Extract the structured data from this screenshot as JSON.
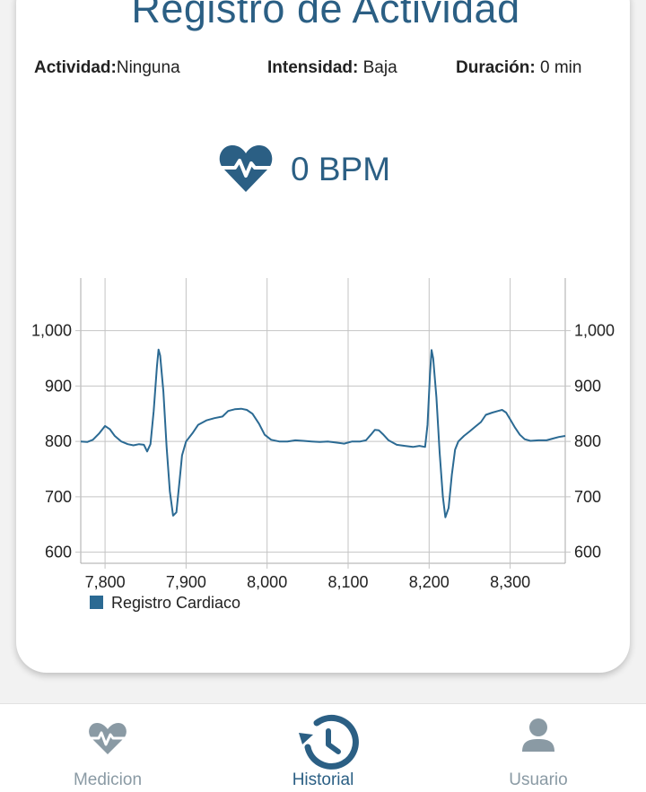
{
  "page": {
    "title": "Registro de Actividad",
    "activity_label": "Actividad:",
    "activity_value": "Ninguna",
    "intensity_label": "Intensidad:",
    "intensity_value": "Baja",
    "duration_label": "Duración:",
    "duration_value": "0 min",
    "heart_icon": "heart-pulse-icon",
    "bpm_value": "0 BPM"
  },
  "chart_data": {
    "type": "line",
    "series": [
      {
        "name": "Registro Cardiaco",
        "color": "#2b6a93",
        "points": [
          [
            7770,
            800
          ],
          [
            7778,
            799
          ],
          [
            7785,
            803
          ],
          [
            7793,
            815
          ],
          [
            7800,
            828
          ],
          [
            7806,
            822
          ],
          [
            7812,
            810
          ],
          [
            7820,
            800
          ],
          [
            7828,
            795
          ],
          [
            7835,
            793
          ],
          [
            7842,
            795
          ],
          [
            7848,
            794
          ],
          [
            7852,
            782
          ],
          [
            7856,
            795
          ],
          [
            7860,
            855
          ],
          [
            7864,
            935
          ],
          [
            7866,
            966
          ],
          [
            7868,
            955
          ],
          [
            7872,
            890
          ],
          [
            7876,
            790
          ],
          [
            7880,
            710
          ],
          [
            7884,
            666
          ],
          [
            7888,
            672
          ],
          [
            7892,
            730
          ],
          [
            7895,
            775
          ],
          [
            7900,
            800
          ],
          [
            7908,
            815
          ],
          [
            7915,
            830
          ],
          [
            7925,
            838
          ],
          [
            7935,
            842
          ],
          [
            7945,
            845
          ],
          [
            7952,
            855
          ],
          [
            7960,
            858
          ],
          [
            7968,
            859
          ],
          [
            7975,
            857
          ],
          [
            7982,
            850
          ],
          [
            7990,
            832
          ],
          [
            7997,
            812
          ],
          [
            8005,
            803
          ],
          [
            8015,
            800
          ],
          [
            8025,
            800
          ],
          [
            8035,
            802
          ],
          [
            8045,
            801
          ],
          [
            8055,
            800
          ],
          [
            8065,
            799
          ],
          [
            8075,
            800
          ],
          [
            8085,
            798
          ],
          [
            8095,
            796
          ],
          [
            8105,
            800
          ],
          [
            8115,
            800
          ],
          [
            8122,
            802
          ],
          [
            8128,
            812
          ],
          [
            8133,
            821
          ],
          [
            8138,
            820
          ],
          [
            8143,
            813
          ],
          [
            8150,
            802
          ],
          [
            8160,
            794
          ],
          [
            8170,
            792
          ],
          [
            8180,
            790
          ],
          [
            8188,
            792
          ],
          [
            8195,
            790
          ],
          [
            8198,
            830
          ],
          [
            8201,
            920
          ],
          [
            8203,
            965
          ],
          [
            8205,
            950
          ],
          [
            8209,
            880
          ],
          [
            8213,
            780
          ],
          [
            8217,
            700
          ],
          [
            8220,
            663
          ],
          [
            8224,
            680
          ],
          [
            8228,
            740
          ],
          [
            8232,
            785
          ],
          [
            8236,
            800
          ],
          [
            8243,
            810
          ],
          [
            8250,
            818
          ],
          [
            8258,
            828
          ],
          [
            8264,
            835
          ],
          [
            8270,
            848
          ],
          [
            8278,
            852
          ],
          [
            8285,
            855
          ],
          [
            8290,
            857
          ],
          [
            8295,
            852
          ],
          [
            8300,
            840
          ],
          [
            8306,
            825
          ],
          [
            8312,
            812
          ],
          [
            8318,
            804
          ],
          [
            8325,
            801
          ],
          [
            8335,
            802
          ],
          [
            8345,
            802
          ],
          [
            8352,
            805
          ],
          [
            8360,
            808
          ],
          [
            8368,
            810
          ]
        ]
      }
    ],
    "xlim": [
      7770,
      8368
    ],
    "ylim": [
      580,
      1095
    ],
    "xticks": [
      "7,800",
      "7,900",
      "8,000",
      "8,100",
      "8,200",
      "8,300"
    ],
    "xtick_values": [
      7800,
      7900,
      8000,
      8100,
      8200,
      8300
    ],
    "yticks": [
      "600",
      "700",
      "800",
      "900",
      "1,000"
    ],
    "ytick_values": [
      600,
      700,
      800,
      900,
      1000
    ],
    "grid": true,
    "legend": "bottom-left",
    "legend_label": "Registro Cardiaco"
  },
  "navbar": {
    "items": [
      {
        "label": "Medicion",
        "icon": "heart-pulse-icon",
        "active": false
      },
      {
        "label": "Historial",
        "icon": "history-icon",
        "active": true
      },
      {
        "label": "Usuario",
        "icon": "user-icon",
        "active": false
      }
    ],
    "active_color": "#2b5f84",
    "inactive_color": "#8a9aa4"
  }
}
